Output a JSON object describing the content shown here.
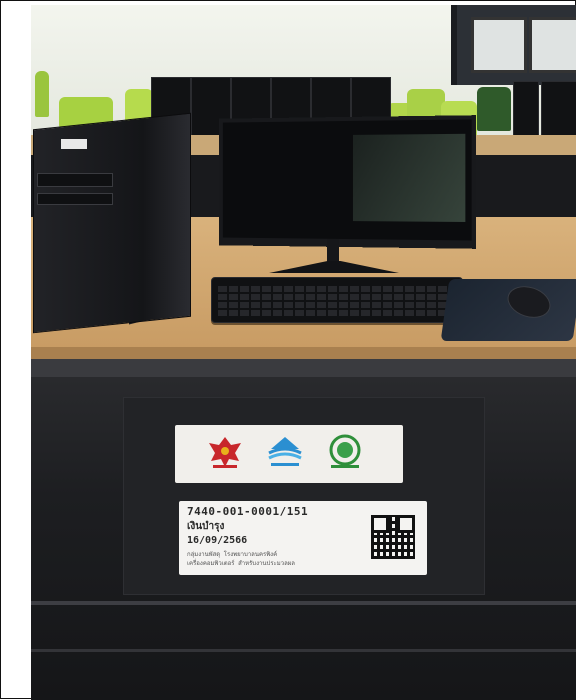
{
  "photo": {
    "subject": "computer-lab-workstation",
    "colors": {
      "desk": "#d9b27c",
      "dark_panel": "#1d1e21",
      "sticker": "#f4f3f1"
    }
  },
  "asset_sticker": {
    "code": "7440-001-0001/151",
    "thai_line": "เงินบำรุง",
    "date": "16/09/2566",
    "small_line_1": "กลุ่มงานพัสดุ โรงพยาบาลนครพิงค์",
    "small_line_2": "เครื่องคอมพิวเตอร์ สำหรับงานประมวลผล"
  },
  "logo_sticker": {
    "logos": [
      "garuda-emblem-icon",
      "ministry-wave-logo-icon",
      "moph-green-seal-icon"
    ]
  }
}
